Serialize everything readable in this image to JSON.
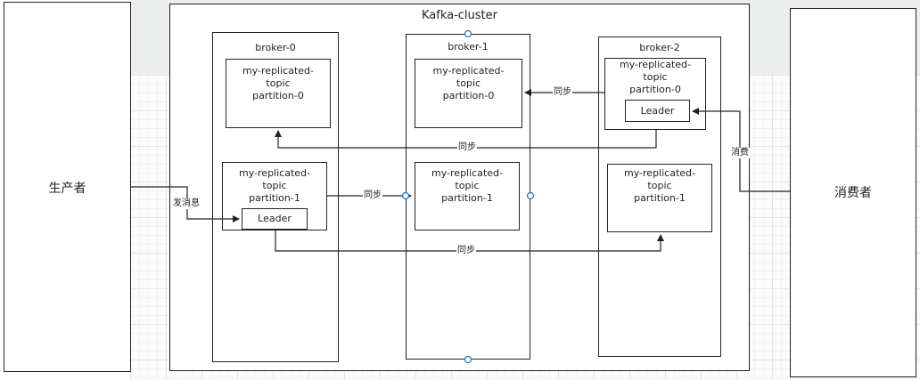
{
  "producer": {
    "label": "生产者"
  },
  "consumer": {
    "label": "消费者"
  },
  "cluster": {
    "title": "Kafka-cluster"
  },
  "brokers": [
    {
      "name": "broker-0",
      "partition0": {
        "line1": "my-replicated-",
        "line2": "topic",
        "line3": "partition-0"
      },
      "partition1": {
        "line1": "my-replicated-",
        "line2": "topic",
        "line3": "partition-1"
      },
      "leader": "Leader"
    },
    {
      "name": "broker-1",
      "partition0": {
        "line1": "my-replicated-",
        "line2": "topic",
        "line3": "partition-0"
      },
      "partition1": {
        "line1": "my-replicated-",
        "line2": "topic",
        "line3": "partition-1"
      }
    },
    {
      "name": "broker-2",
      "partition0": {
        "line1": "my-replicated-",
        "line2": "topic",
        "line3": "partition-0"
      },
      "partition1": {
        "line1": "my-replicated-",
        "line2": "topic",
        "line3": "partition-1"
      },
      "leader": "Leader"
    }
  ],
  "edges": {
    "send": "发消息",
    "consume": "消费",
    "sync_b2_b1": "同步",
    "sync_b2_b0": "同步",
    "sync_b0_b1": "同步",
    "sync_b0_b2": "同步"
  },
  "colors": {
    "line": "#222222",
    "connector": "#1a73c8"
  }
}
